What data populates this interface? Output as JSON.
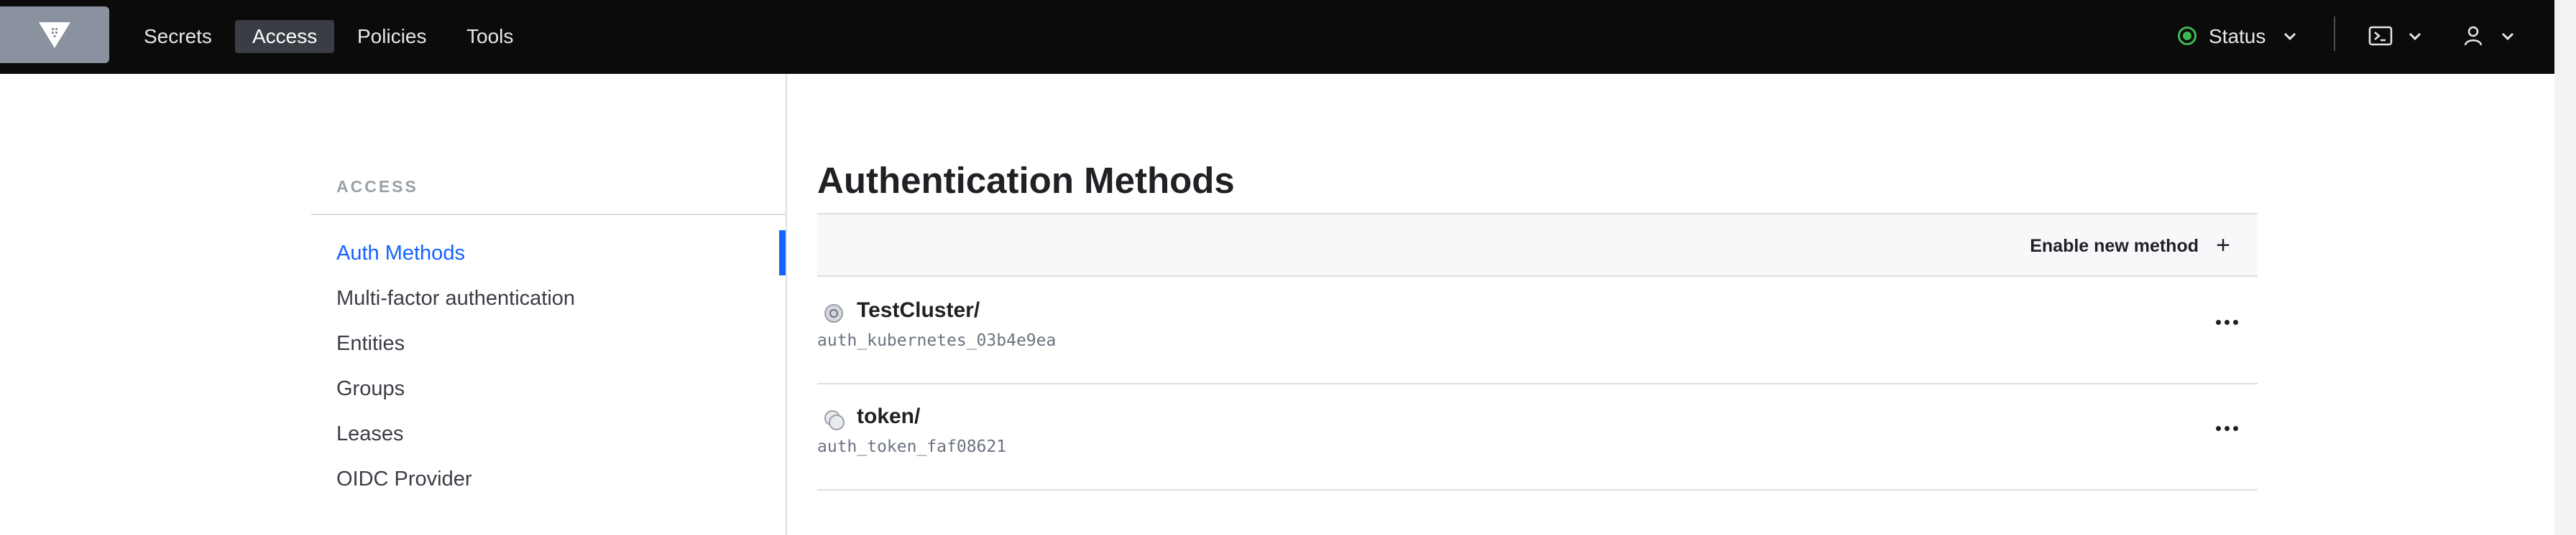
{
  "nav": {
    "items": [
      {
        "label": "Secrets",
        "active": false
      },
      {
        "label": "Access",
        "active": true
      },
      {
        "label": "Policies",
        "active": false
      },
      {
        "label": "Tools",
        "active": false
      }
    ],
    "status_label": "Status",
    "status_color": "#3fb950"
  },
  "sidebar": {
    "heading": "ACCESS",
    "items": [
      {
        "label": "Auth Methods",
        "active": true
      },
      {
        "label": "Multi-factor authentication",
        "active": false
      },
      {
        "label": "Entities",
        "active": false
      },
      {
        "label": "Groups",
        "active": false
      },
      {
        "label": "Leases",
        "active": false
      },
      {
        "label": "OIDC Provider",
        "active": false
      }
    ]
  },
  "main": {
    "title": "Authentication Methods",
    "enable_label": "Enable new method",
    "enable_icon": "+",
    "methods": [
      {
        "path": "TestCluster/",
        "accessor": "auth_kubernetes_03b4e9ea",
        "icon": "kubernetes-icon"
      },
      {
        "path": "token/",
        "accessor": "auth_token_faf08621",
        "icon": "token-icon"
      }
    ]
  },
  "colors": {
    "accent": "#1563ff",
    "topbar": "#0b0b0b"
  }
}
